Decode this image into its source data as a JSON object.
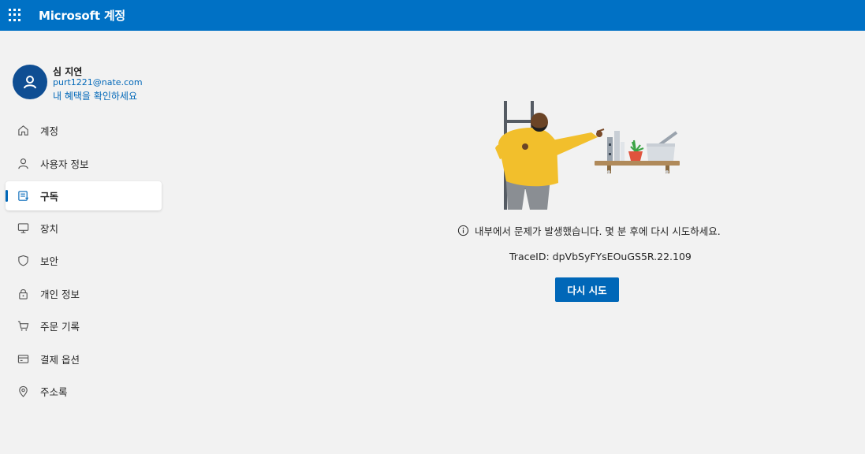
{
  "header": {
    "brand": "Microsoft 계정",
    "waffle_icon": "app-launcher-icon",
    "color": "#0071c5"
  },
  "profile": {
    "name": "심 지연",
    "email": "purt1221@nate.com",
    "benefits_link": "내 혜택을 확인하세요",
    "avatar_icon": "person-icon",
    "avatar_color": "#0f4e93"
  },
  "nav": {
    "items": [
      {
        "label": "계정",
        "icon": "home-icon"
      },
      {
        "label": "사용자 정보",
        "icon": "person-icon"
      },
      {
        "label": "구독",
        "icon": "subscription-icon",
        "active": true
      },
      {
        "label": "장치",
        "icon": "monitor-icon"
      },
      {
        "label": "보안",
        "icon": "shield-icon"
      },
      {
        "label": "개인 정보",
        "icon": "lock-icon"
      },
      {
        "label": "주문 기록",
        "icon": "cart-icon"
      },
      {
        "label": "결제 옵션",
        "icon": "credit-card-icon"
      },
      {
        "label": "주소록",
        "icon": "location-pin-icon"
      }
    ]
  },
  "main": {
    "error_message": "내부에서 문제가 발생했습니다. 몇 분 후에 다시 시도하세요.",
    "trace_text": "TraceID: dpVbSyFYsEOuGS5R.22.109",
    "retry_label": "다시 시도",
    "accent": "#0067b8"
  }
}
